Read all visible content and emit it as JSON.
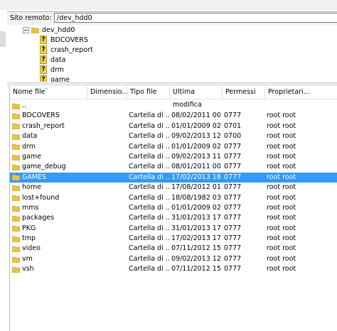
{
  "path_bar": {
    "label": "Sito remoto:",
    "value": "/dev_hdd0"
  },
  "tree": {
    "root": {
      "label": "dev_hdd0",
      "icon": "folder-icon"
    },
    "children": [
      {
        "label": "BDCOVERS",
        "icon": "question-icon"
      },
      {
        "label": "crash_report",
        "icon": "question-icon"
      },
      {
        "label": "data",
        "icon": "question-icon"
      },
      {
        "label": "drm",
        "icon": "question-icon"
      },
      {
        "label": "game",
        "icon": "question-icon"
      }
    ]
  },
  "file_list": {
    "columns": [
      "Nome file",
      "Dimensio...",
      "Tipo file",
      "Ultima modifica",
      "Permessi",
      "Proprietari..."
    ],
    "rows": [
      {
        "name": "..",
        "size": "",
        "type": "",
        "modified": "",
        "perms": "",
        "owner": ""
      },
      {
        "name": "BDCOVERS",
        "size": "",
        "type": "Cartella di ...",
        "modified": "08/02/2011 00....",
        "perms": "0777",
        "owner": "root root"
      },
      {
        "name": "crash_report",
        "size": "",
        "type": "Cartella di ...",
        "modified": "01/01/2009 02....",
        "perms": "0701",
        "owner": "root root"
      },
      {
        "name": "data",
        "size": "",
        "type": "Cartella di ...",
        "modified": "09/02/2013 12....",
        "perms": "0700",
        "owner": "root root"
      },
      {
        "name": "drm",
        "size": "",
        "type": "Cartella di ...",
        "modified": "01/01/2009 02....",
        "perms": "0777",
        "owner": "root root"
      },
      {
        "name": "game",
        "size": "",
        "type": "Cartella di ...",
        "modified": "09/02/2013 11....",
        "perms": "0777",
        "owner": "root root"
      },
      {
        "name": "game_debug",
        "size": "",
        "type": "Cartella di ...",
        "modified": "08/01/2011 00....",
        "perms": "0777",
        "owner": "root root"
      },
      {
        "name": "GAMES",
        "size": "",
        "type": "Cartella di ...",
        "modified": "17/02/2013 18....",
        "perms": "0777",
        "owner": "root root",
        "selected": true
      },
      {
        "name": "home",
        "size": "",
        "type": "Cartella di ...",
        "modified": "17/08/2012 01....",
        "perms": "0777",
        "owner": "root root"
      },
      {
        "name": "lost+found",
        "size": "",
        "type": "Cartella di ...",
        "modified": "18/08/1982 03....",
        "perms": "0777",
        "owner": "root root"
      },
      {
        "name": "mms",
        "size": "",
        "type": "Cartella di ...",
        "modified": "01/01/2009 02....",
        "perms": "0777",
        "owner": "root root"
      },
      {
        "name": "packages",
        "size": "",
        "type": "Cartella di ...",
        "modified": "31/01/2013 17....",
        "perms": "0777",
        "owner": "root root"
      },
      {
        "name": "PKG",
        "size": "",
        "type": "Cartella di ...",
        "modified": "31/01/2013 17....",
        "perms": "0777",
        "owner": "root root"
      },
      {
        "name": "tmp",
        "size": "",
        "type": "Cartella di ...",
        "modified": "17/02/2013 17....",
        "perms": "0777",
        "owner": "root root"
      },
      {
        "name": "video",
        "size": "",
        "type": "Cartella di ...",
        "modified": "07/11/2012 15....",
        "perms": "0777",
        "owner": "root root"
      },
      {
        "name": "vm",
        "size": "",
        "type": "Cartella di ...",
        "modified": "09/02/2013 12....",
        "perms": "0777",
        "owner": "root root"
      },
      {
        "name": "vsh",
        "size": "",
        "type": "Cartella di ...",
        "modified": "07/11/2012 15....",
        "perms": "0777",
        "owner": "root root"
      }
    ]
  },
  "colors": {
    "selection": "#3399ff",
    "folder": "#e8c24a"
  }
}
